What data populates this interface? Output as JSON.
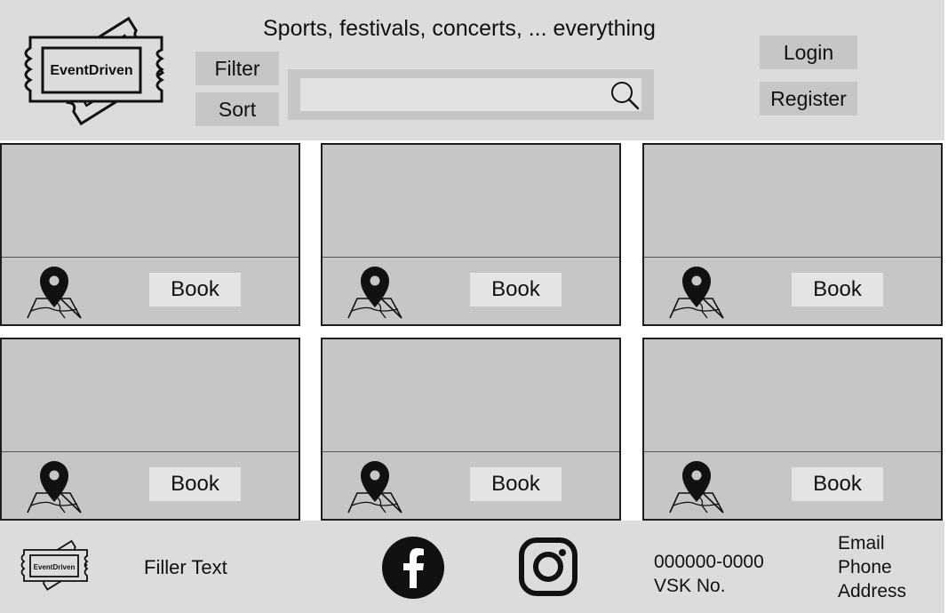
{
  "brand": {
    "name": "EventDriven"
  },
  "header": {
    "tagline": "Sports, festivals, concerts, ... everything",
    "filter_label": "Filter",
    "sort_label": "Sort",
    "search": {
      "value": "",
      "placeholder": "",
      "icon": "search-icon"
    },
    "login_label": "Login",
    "register_label": "Register"
  },
  "events": [
    {
      "book_label": "Book",
      "map_icon": "map-pin-icon"
    },
    {
      "book_label": "Book",
      "map_icon": "map-pin-icon"
    },
    {
      "book_label": "Book",
      "map_icon": "map-pin-icon"
    },
    {
      "book_label": "Book",
      "map_icon": "map-pin-icon"
    },
    {
      "book_label": "Book",
      "map_icon": "map-pin-icon"
    },
    {
      "book_label": "Book",
      "map_icon": "map-pin-icon"
    }
  ],
  "footer": {
    "filler_text": "Filler Text",
    "social": [
      "facebook-icon",
      "instagram-icon"
    ],
    "phone_number": "000000-0000",
    "vsk_number": "VSK No.",
    "contact": {
      "email": "Email",
      "phone": "Phone",
      "address": "Address"
    }
  },
  "colors": {
    "header_bg": "#dcdcdc",
    "button_bg": "#c6c6c6",
    "card_bg": "#c6c6c6",
    "book_button_bg": "#e4e4e4",
    "icon": "#111111"
  }
}
